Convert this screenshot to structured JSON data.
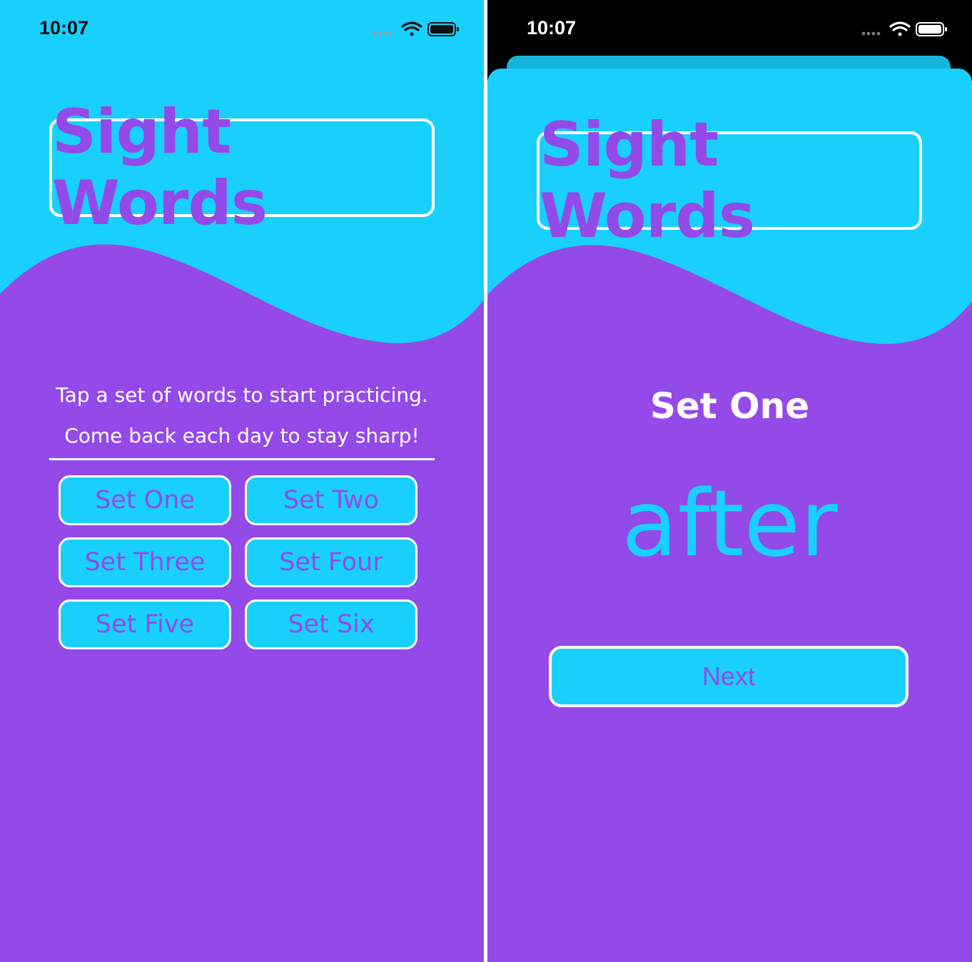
{
  "colors": {
    "cyan": "#19d0fc",
    "purple": "#9449e9",
    "white": "#ffffff"
  },
  "left_screen": {
    "status_time": "10:07",
    "title": "Sight Words",
    "instructions": {
      "line1": "Tap a set of words to start practicing.",
      "line2": "Come back each day to stay sharp!"
    },
    "sets": [
      {
        "label": "Set One"
      },
      {
        "label": "Set Two"
      },
      {
        "label": "Set Three"
      },
      {
        "label": "Set Four"
      },
      {
        "label": "Set Five"
      },
      {
        "label": "Set Six"
      }
    ]
  },
  "right_screen": {
    "status_time": "10:07",
    "title": "Sight Words",
    "set_heading": "Set One",
    "current_word": "after",
    "next_label": "Next"
  },
  "icons": [
    "signal-dots-icon",
    "wifi-icon",
    "battery-icon"
  ]
}
